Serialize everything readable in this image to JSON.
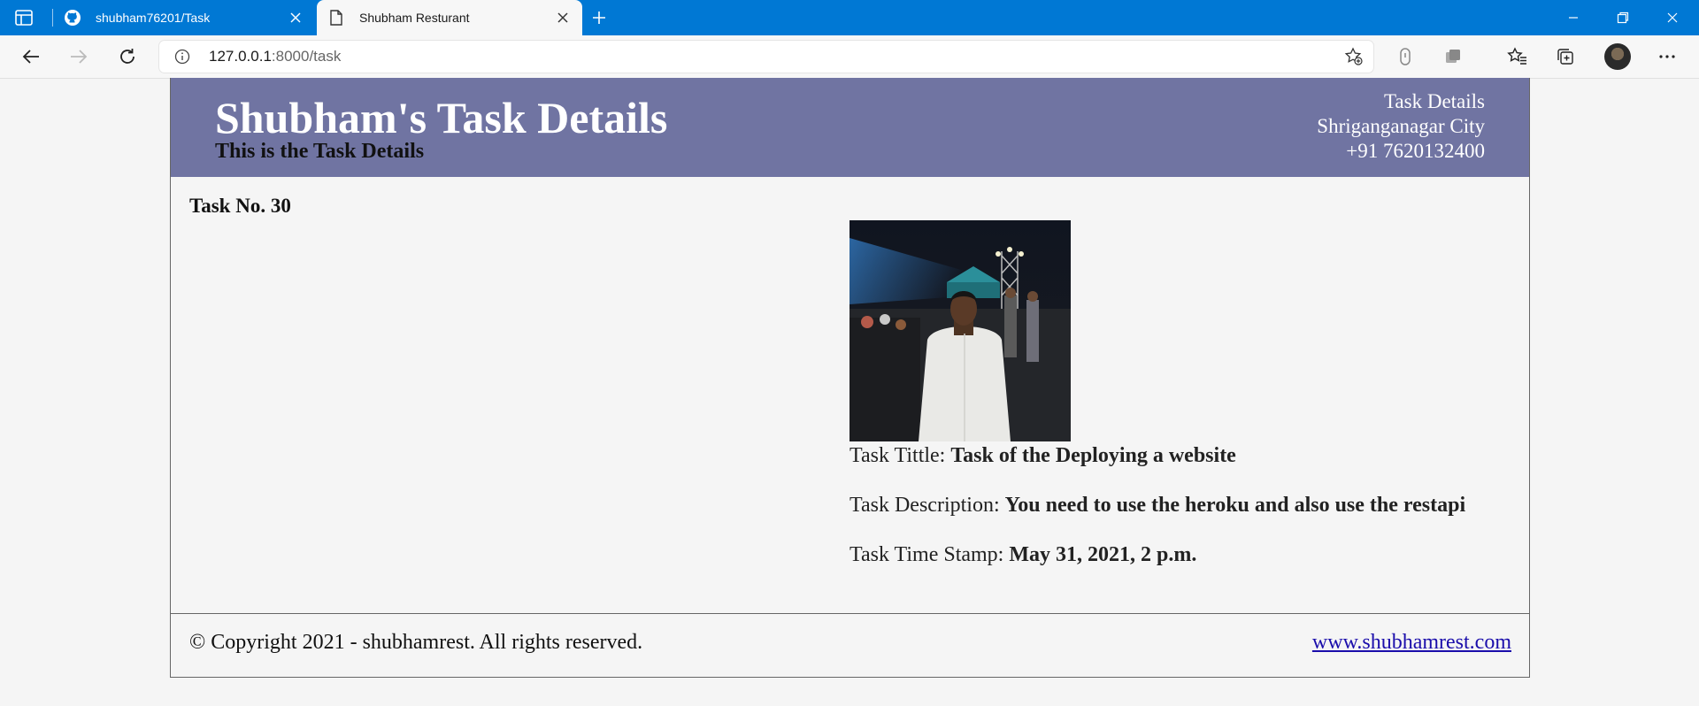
{
  "browser": {
    "tabs": [
      {
        "label": "shubham76201/Task",
        "icon": "github-icon"
      },
      {
        "label": "Shubham Resturant",
        "icon": "page-icon",
        "active": true
      }
    ],
    "address": {
      "host": "127.0.0.1",
      "path": ":8000/task"
    }
  },
  "header": {
    "title": "Shubham's Task Details",
    "subtitle": "This is the Task Details",
    "right_lines": [
      "Task Details",
      "Shriganganagar City",
      "+91 7620132400"
    ]
  },
  "task": {
    "number_label": "Task No. 30",
    "title_label": "Task Tittle:",
    "title_value": "Task of the Deploying a website",
    "description_label": "Task Description:",
    "description_value": "You need to use the heroku and also use the restapi",
    "timestamp_label": "Task Time Stamp:",
    "timestamp_value": "May 31, 2021, 2 p.m."
  },
  "footer": {
    "copyright": "© Copyright 2021 - shubhamrest. All rights reserved.",
    "link": "www.shubhamrest.com"
  },
  "colors": {
    "tabbar": "#0078d4",
    "header": "#7074a2"
  }
}
